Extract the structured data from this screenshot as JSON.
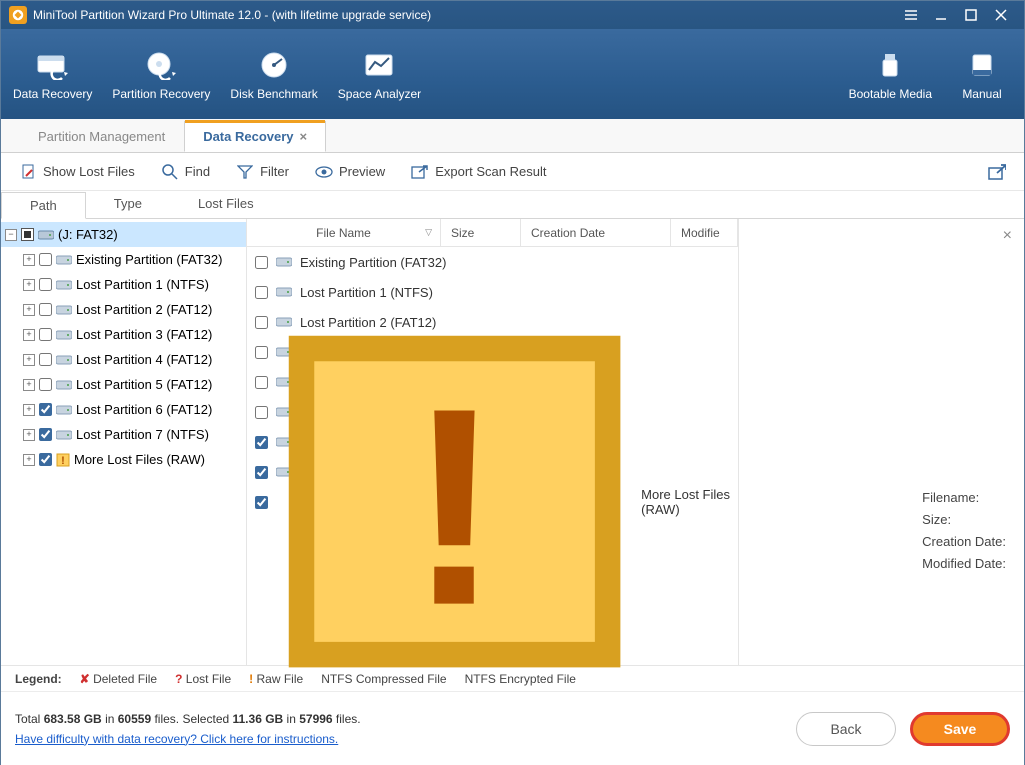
{
  "title": "MiniTool Partition Wizard Pro Ultimate 12.0 - (with lifetime upgrade service)",
  "ribbon": {
    "data_recovery": "Data Recovery",
    "partition_recovery": "Partition Recovery",
    "disk_benchmark": "Disk Benchmark",
    "space_analyzer": "Space Analyzer",
    "bootable_media": "Bootable Media",
    "manual": "Manual"
  },
  "tabs": {
    "partition_mgmt": "Partition Management",
    "data_recovery": "Data Recovery"
  },
  "toolbar": {
    "show_lost": "Show Lost Files",
    "find": "Find",
    "filter": "Filter",
    "preview": "Preview",
    "export": "Export Scan Result"
  },
  "viewtabs": {
    "path": "Path",
    "type": "Type",
    "lostfiles": "Lost Files"
  },
  "tree": {
    "root": "(J: FAT32)",
    "items": [
      {
        "label": "Existing Partition (FAT32)",
        "checked": false
      },
      {
        "label": "Lost Partition 1 (NTFS)",
        "checked": false
      },
      {
        "label": "Lost Partition 2 (FAT12)",
        "checked": false
      },
      {
        "label": "Lost Partition 3 (FAT12)",
        "checked": false
      },
      {
        "label": "Lost Partition 4 (FAT12)",
        "checked": false
      },
      {
        "label": "Lost Partition 5 (FAT12)",
        "checked": false
      },
      {
        "label": "Lost Partition 6 (FAT12)",
        "checked": true
      },
      {
        "label": "Lost Partition 7 (NTFS)",
        "checked": true
      },
      {
        "label": "More Lost Files (RAW)",
        "checked": true,
        "warn": true
      }
    ]
  },
  "fl_headers": {
    "name": "File Name",
    "size": "Size",
    "cdate": "Creation Date",
    "mdate": "Modifie"
  },
  "filelist": [
    {
      "label": "Existing Partition (FAT32)",
      "checked": false
    },
    {
      "label": "Lost Partition 1 (NTFS)",
      "checked": false
    },
    {
      "label": "Lost Partition 2 (FAT12)",
      "checked": false
    },
    {
      "label": "Lost Partition 3 (FAT12)",
      "checked": false
    },
    {
      "label": "Lost Partition 4 (FAT12)",
      "checked": false
    },
    {
      "label": "Lost Partition 5 (FAT12)",
      "checked": false
    },
    {
      "label": "Lost Partition 6 (FAT12)",
      "checked": true
    },
    {
      "label": "Lost Partition 7 (NTFS)",
      "checked": true
    },
    {
      "label": "More Lost Files (RAW)",
      "checked": true,
      "warn": true
    }
  ],
  "details": {
    "filename": "Filename:",
    "size": "Size:",
    "cdate": "Creation Date:",
    "mdate": "Modified Date:"
  },
  "legend": {
    "label": "Legend:",
    "deleted": "Deleted File",
    "lost": "Lost File",
    "raw": "Raw File",
    "ntfs_comp": "NTFS Compressed File",
    "ntfs_enc": "NTFS Encrypted File"
  },
  "status": {
    "totals_pre": "Total ",
    "total_gb": "683.58 GB",
    "in1": " in ",
    "total_files": "60559",
    "files1": " files.   Selected ",
    "sel_gb": "11.36 GB",
    "in2": " in ",
    "sel_files": "57996",
    "files2": " files.",
    "help": "Have difficulty with data recovery? Click here for instructions.",
    "back": "Back",
    "save": "Save"
  }
}
